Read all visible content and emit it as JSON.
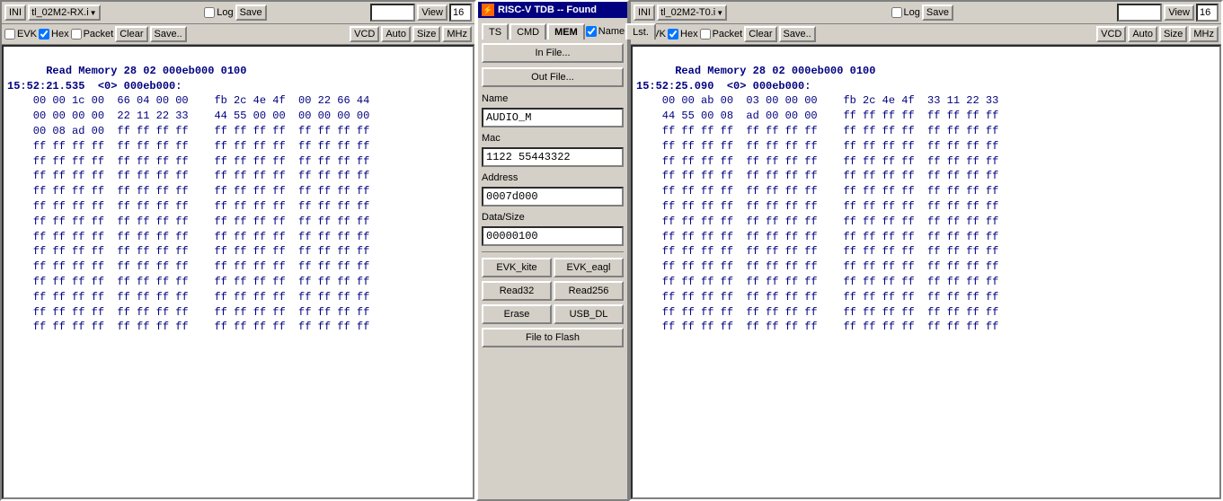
{
  "title": "RISC-V TDB -- Found",
  "left_panel": {
    "toolbar1": {
      "ini_label": "INI",
      "device_label": "tl_02M2-RX.i",
      "log_label": "Log",
      "save_label": "Save",
      "view_label": "View",
      "view_value": "16"
    },
    "toolbar2": {
      "evk_label": "EVK",
      "hex_label": "Hex",
      "hex_checked": true,
      "packet_label": "Packet",
      "clear_label": "Clear",
      "savedots_label": "Save..",
      "vcd_label": "VCD",
      "auto_label": "Auto",
      "size_label": "Size",
      "mhz_label": "MHz"
    },
    "hex_header1": "Read Memory 28 02 000eb000 0100",
    "hex_header2": "15:52:21.535  <0> 000eb000:",
    "hex_data": [
      "    00 00 1c 00  66 04 00 00    fb 2c 4e 4f  00 22 66 44",
      "    00 00 00 00  22 11 22 33    44 55 00 00  00 00 00 00",
      "    00 08 ad 00  ff ff ff ff    ff ff ff ff  ff ff ff ff",
      "    ff ff ff ff  ff ff ff ff    ff ff ff ff  ff ff ff ff",
      "    ff ff ff ff  ff ff ff ff    ff ff ff ff  ff ff ff ff",
      "    ff ff ff ff  ff ff ff ff    ff ff ff ff  ff ff ff ff",
      "    ff ff ff ff  ff ff ff ff    ff ff ff ff  ff ff ff ff",
      "    ff ff ff ff  ff ff ff ff    ff ff ff ff  ff ff ff ff",
      "    ff ff ff ff  ff ff ff ff    ff ff ff ff  ff ff ff ff",
      "    ff ff ff ff  ff ff ff ff    ff ff ff ff  ff ff ff ff",
      "    ff ff ff ff  ff ff ff ff    ff ff ff ff  ff ff ff ff",
      "    ff ff ff ff  ff ff ff ff    ff ff ff ff  ff ff ff ff",
      "    ff ff ff ff  ff ff ff ff    ff ff ff ff  ff ff ff ff",
      "    ff ff ff ff  ff ff ff ff    ff ff ff ff  ff ff ff ff",
      "    ff ff ff ff  ff ff ff ff    ff ff ff ff  ff ff ff ff",
      "    ff ff ff ff  ff ff ff ff    ff ff ff ff  ff ff ff ff"
    ]
  },
  "dialog": {
    "title": "RISC-V TDB -- Found",
    "tabs": {
      "ts_label": "TS",
      "cmd_label": "CMD",
      "mem_label": "MEM",
      "name_label": "Name",
      "name_checked": true,
      "lst_label": "Lst."
    },
    "in_file_label": "In File...",
    "out_file_label": "Out File...",
    "name_field_label": "Name",
    "name_value": "AUDIO_M",
    "mac_field_label": "Mac",
    "mac_value": "1122 55443322",
    "address_field_label": "Address",
    "address_value": "0007d000",
    "data_size_field_label": "Data/Size",
    "data_size_value": "00000100",
    "evk_kite_label": "EVK_kite",
    "evk_eagle_label": "EVK_eagl",
    "read32_label": "Read32",
    "read256_label": "Read256",
    "erase_label": "Erase",
    "usb_dl_label": "USB_DL",
    "file_to_flash_label": "File to Flash"
  },
  "right_panel": {
    "toolbar1": {
      "ini_label": "INI",
      "device_label": "tl_02M2-T0.i",
      "log_label": "Log",
      "save_label": "Save",
      "view_label": "View",
      "view_value": "16"
    },
    "toolbar2": {
      "evk_label": "EVK",
      "hex_label": "Hex",
      "hex_checked": true,
      "packet_label": "Packet",
      "clear_label": "Clear",
      "savedots_label": "Save..",
      "vcd_label": "VCD",
      "auto_label": "Auto",
      "size_label": "Size",
      "mhz_label": "MHz"
    },
    "hex_header1": "Read Memory 28 02 000eb000 0100",
    "hex_header2": "15:52:25.090  <0> 000eb000:",
    "hex_data": [
      "    00 00 ab 00  03 00 00 00    fb 2c 4e 4f  33 11 22 33",
      "    44 55 00 08  ad 00 00 00    ff ff ff ff  ff ff ff ff",
      "    ff ff ff ff  ff ff ff ff    ff ff ff ff  ff ff ff ff",
      "    ff ff ff ff  ff ff ff ff    ff ff ff ff  ff ff ff ff",
      "    ff ff ff ff  ff ff ff ff    ff ff ff ff  ff ff ff ff",
      "    ff ff ff ff  ff ff ff ff    ff ff ff ff  ff ff ff ff",
      "    ff ff ff ff  ff ff ff ff    ff ff ff ff  ff ff ff ff",
      "    ff ff ff ff  ff ff ff ff    ff ff ff ff  ff ff ff ff",
      "    ff ff ff ff  ff ff ff ff    ff ff ff ff  ff ff ff ff",
      "    ff ff ff ff  ff ff ff ff    ff ff ff ff  ff ff ff ff",
      "    ff ff ff ff  ff ff ff ff    ff ff ff ff  ff ff ff ff",
      "    ff ff ff ff  ff ff ff ff    ff ff ff ff  ff ff ff ff",
      "    ff ff ff ff  ff ff ff ff    ff ff ff ff  ff ff ff ff",
      "    ff ff ff ff  ff ff ff ff    ff ff ff ff  ff ff ff ff",
      "    ff ff ff ff  ff ff ff ff    ff ff ff ff  ff ff ff ff",
      "    ff ff ff ff  ff ff ff ff    ff ff ff ff  ff ff ff ff"
    ]
  }
}
